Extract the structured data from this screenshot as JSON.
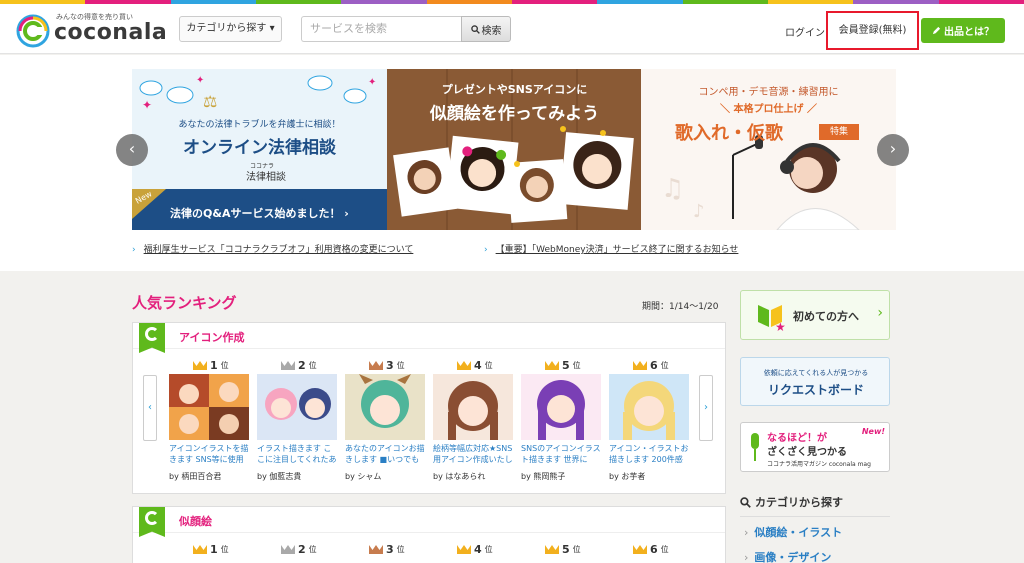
{
  "header": {
    "logo_tagline": "みんなの得意を売り買い",
    "logo_text": "coconala",
    "category_button": "カテゴリから探す ▾",
    "search_placeholder": "サービスを検索",
    "search_button": "検索",
    "login": "ログイン",
    "register": "会員登録(無料)",
    "sell_button": "出品とは？"
  },
  "banners": [
    {
      "top": "あなたの法律トラブルを弁護士に相談！",
      "title": "オンライン法律相談",
      "brand_small": "ココナラ",
      "brand": "法律相談",
      "badge": "New",
      "footer": "法律のQ&Aサービス始めました！ ›"
    },
    {
      "line1": "プレゼントやSNSアイコンに",
      "line2": "似顔絵を作ってみよう"
    },
    {
      "line1": "コンペ用・デモ音源・練習用に",
      "line2": "＼ 本格プロ仕上げ ／",
      "line3": "歌入れ・仮歌",
      "tag": "特集"
    }
  ],
  "news": [
    "福利厚生サービス「ココナラクラブオフ」利用資格の変更について",
    "【重要】「WebMoney決済」サービス終了に関するお知らせ"
  ],
  "ranking": {
    "title": "人気ランキング",
    "period": "期間：1/14〜1/20",
    "rank_suffix": "位",
    "sections": [
      {
        "title": "アイコン作成",
        "items": [
          {
            "rank": "1",
            "desc": "アイコンイラストを描きます SNS等に使用",
            "seller": "by 柄田百合君"
          },
          {
            "rank": "2",
            "desc": "イラスト描きます こ こに注目してくれたあ",
            "seller": "by 伽藍志貴"
          },
          {
            "rank": "3",
            "desc": "あなたのアイコンお描きします ■いつでも",
            "seller": "by シャム"
          },
          {
            "rank": "4",
            "desc": "絵柄等幅広対応★SNS用アイコン作成いたし",
            "seller": "by はなあられ"
          },
          {
            "rank": "5",
            "desc": "SNSのアイコンイラスト描きます 世界に",
            "seller": "by 熊岡熊子"
          },
          {
            "rank": "6",
            "desc": "アイコン・イラストお描きします 200件感",
            "seller": "by お芋者"
          }
        ]
      },
      {
        "title": "似顔絵",
        "items": [
          {
            "rank": "1"
          },
          {
            "rank": "2"
          },
          {
            "rank": "3"
          },
          {
            "rank": "4"
          },
          {
            "rank": "5"
          },
          {
            "rank": "6"
          }
        ]
      }
    ]
  },
  "sidebar": {
    "beginner": "初めての方へ",
    "request_sub": "依頼に応えてくれる人が見つかる",
    "request": "リクエストボード",
    "mag_line1": "なるほど！が",
    "mag_line2": "ざくざく見つかる",
    "mag_sub": "ココナラ活用マガジン coconala mag",
    "mag_badge": "New!",
    "category_heading": "カテゴリから探す",
    "categories": [
      "似顔絵・イラスト",
      "画像・デザイン"
    ]
  },
  "colors": {
    "brand_green": "#5fb91c",
    "brand_pink": "#e3207d",
    "link_blue": "#2a7fc4",
    "highlight_red": "#e8192c",
    "crown_gold": "#f2b01e",
    "crown_silver": "#a9a9a9",
    "crown_bronze": "#c77c4e"
  }
}
